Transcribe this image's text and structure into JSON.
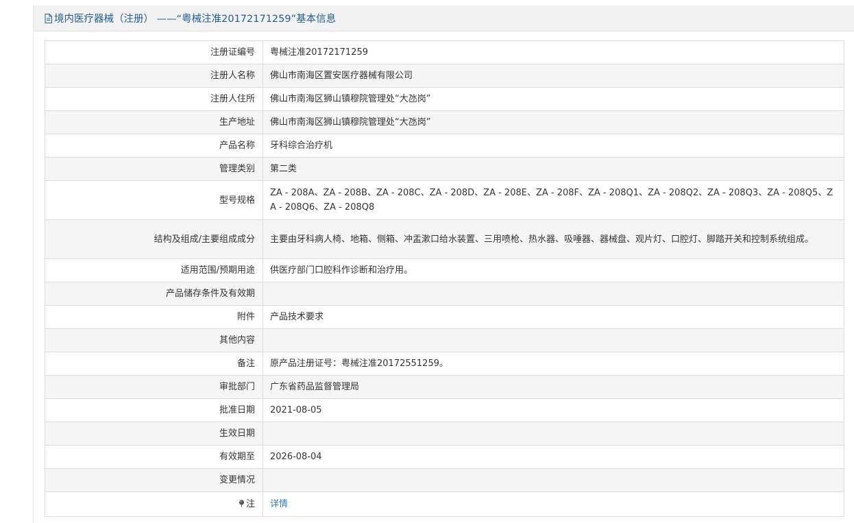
{
  "header": {
    "icon": "document-icon",
    "title": "境内医疗器械（注册） ——“粤械注准20172171259”基本信息"
  },
  "rows": [
    {
      "label": "注册证编号",
      "value": "粤械注准20172171259"
    },
    {
      "label": "注册人名称",
      "value": "佛山市南海区置安医疗器械有限公司"
    },
    {
      "label": "注册人住所",
      "value": "佛山市南海区狮山镇穆院管理处“大氹岗”"
    },
    {
      "label": "生产地址",
      "value": "佛山市南海区狮山镇穆院管理处“大氹岗”"
    },
    {
      "label": "产品名称",
      "value": "牙科综合治疗机"
    },
    {
      "label": "管理类别",
      "value": "第二类"
    },
    {
      "label": "型号规格",
      "value": "ZA - 208A、ZA - 208B、ZA - 208C、ZA - 208D、ZA - 208E、ZA - 208F、ZA - 208Q1、ZA - 208Q2、ZA - 208Q3、ZA - 208Q5、ZA - 208Q6、ZA - 208Q8"
    },
    {
      "label": "结构及组成/主要组成成分",
      "value": "主要由牙科病人椅、地箱、侧箱、冲盂漱口给水装置、三用喷枪、热水器、吸唾器、器械盘、观片灯、口腔灯、脚踏开关和控制系统组成。"
    },
    {
      "label": "适用范围/预期用途",
      "value": "供医疗部门口腔科作诊断和治疗用。"
    },
    {
      "label": "产品储存条件及有效期",
      "value": ""
    },
    {
      "label": "附件",
      "value": "产品技术要求"
    },
    {
      "label": "其他内容",
      "value": ""
    },
    {
      "label": "备注",
      "value": "原产品注册证号：粤械注准20172551259。"
    },
    {
      "label": "审批部门",
      "value": "广东省药品监督管理局"
    },
    {
      "label": "批准日期",
      "value": "2021-08-05"
    },
    {
      "label": "生效日期",
      "value": ""
    },
    {
      "label": "有效期至",
      "value": "2026-08-04"
    },
    {
      "label": "变更情况",
      "value": ""
    }
  ],
  "note": {
    "icon": "pin-icon",
    "label": "注",
    "link_text": "详情"
  },
  "colors": {
    "title": "#1f5d94",
    "link": "#2a7ab8",
    "row_alt": "#f5f5f5",
    "header_bg": "#f2f2f2"
  }
}
